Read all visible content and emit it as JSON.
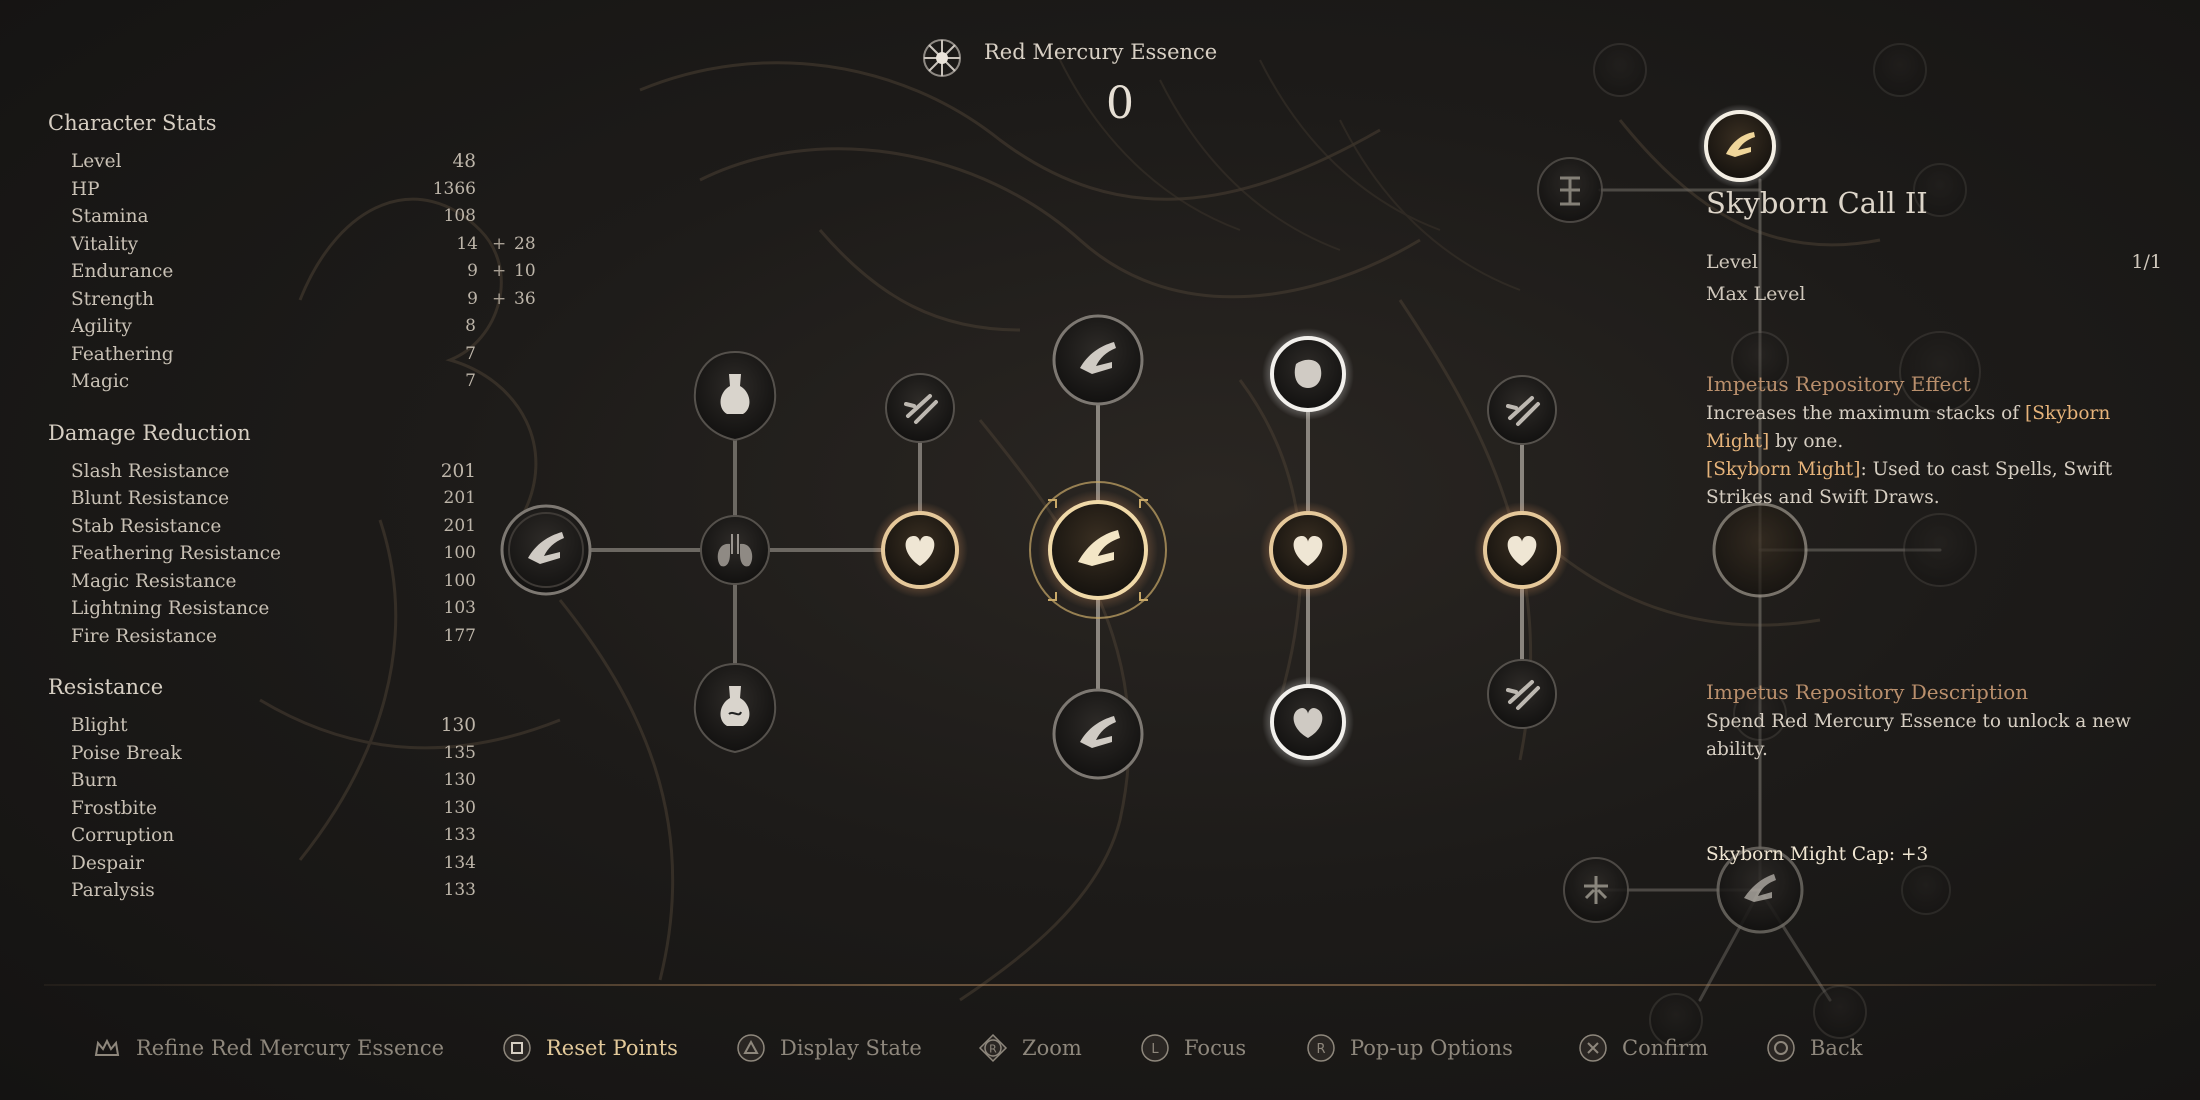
{
  "currency": {
    "label": "Red Mercury Essence",
    "value": "0",
    "icon": "mercury-sigil-icon"
  },
  "character_stats": {
    "title": "Character Stats",
    "rows": [
      {
        "name": "Level",
        "value": "48"
      },
      {
        "name": "HP",
        "value": "1366"
      },
      {
        "name": "Stamina",
        "value": "108"
      },
      {
        "name": "Vitality",
        "base": "14",
        "plus": "+",
        "bonus": "28"
      },
      {
        "name": "Endurance",
        "base": "9",
        "plus": "+",
        "bonus": "10"
      },
      {
        "name": "Strength",
        "base": "9",
        "plus": "+",
        "bonus": "36"
      },
      {
        "name": "Agility",
        "value": "8"
      },
      {
        "name": "Feathering",
        "value": "7"
      },
      {
        "name": "Magic",
        "value": "7"
      }
    ]
  },
  "damage_reduction": {
    "title": "Damage Reduction",
    "rows": [
      {
        "name": "Slash Resistance",
        "value": "201"
      },
      {
        "name": "Blunt Resistance",
        "value": "201"
      },
      {
        "name": "Stab Resistance",
        "value": "201"
      },
      {
        "name": "Feathering Resistance",
        "value": "100"
      },
      {
        "name": "Magic Resistance",
        "value": "100"
      },
      {
        "name": "Lightning Resistance",
        "value": "103"
      },
      {
        "name": "Fire Resistance",
        "value": "177"
      }
    ]
  },
  "resistance": {
    "title": "Resistance",
    "rows": [
      {
        "name": "Blight",
        "value": "130"
      },
      {
        "name": "Poise Break",
        "value": "135"
      },
      {
        "name": "Burn",
        "value": "130"
      },
      {
        "name": "Frostbite",
        "value": "130"
      },
      {
        "name": "Corruption",
        "value": "133"
      },
      {
        "name": "Despair",
        "value": "134"
      },
      {
        "name": "Paralysis",
        "value": "133"
      }
    ]
  },
  "detail": {
    "title": "Skyborn Call II",
    "level_label": "Level",
    "level_value": "1/1",
    "max_level": "Max Level",
    "effect_title": "Impetus Repository Effect",
    "effect_line1_a": "Increases the maximum stacks of ",
    "effect_line1_hl": "[Skyborn Might]",
    "effect_line1_b": " by one.",
    "effect_line2_hl": "[Skyborn Might]",
    "effect_line2_b": ": Used to cast Spells, Swift Strikes and Swift Draws.",
    "desc_title": "Impetus Repository Description",
    "desc_text": "Spend Red Mercury Essence to unlock a new ability.",
    "cap": "Skyborn Might Cap: +3"
  },
  "actions": [
    {
      "label": "Refine Red Mercury Essence",
      "icon": "crown-icon",
      "active": false
    },
    {
      "label": "Reset Points",
      "icon": "square-button-icon",
      "active": true
    },
    {
      "label": "Display State",
      "icon": "triangle-button-icon",
      "active": false
    },
    {
      "label": "Zoom",
      "icon": "r-stick-icon",
      "active": false
    },
    {
      "label": "Focus",
      "icon": "l-stick-icon",
      "active": false
    },
    {
      "label": "Pop-up Options",
      "icon": "r-button-icon",
      "active": false
    },
    {
      "label": "Confirm",
      "icon": "cross-button-icon",
      "active": false
    },
    {
      "label": "Back",
      "icon": "circle-button-icon",
      "active": false
    }
  ],
  "colors": {
    "accent_gold": "#e2c99a",
    "highlight_orange": "#e6b37a",
    "section_brown": "#b98f6c",
    "active_path": "#e89a6a"
  }
}
